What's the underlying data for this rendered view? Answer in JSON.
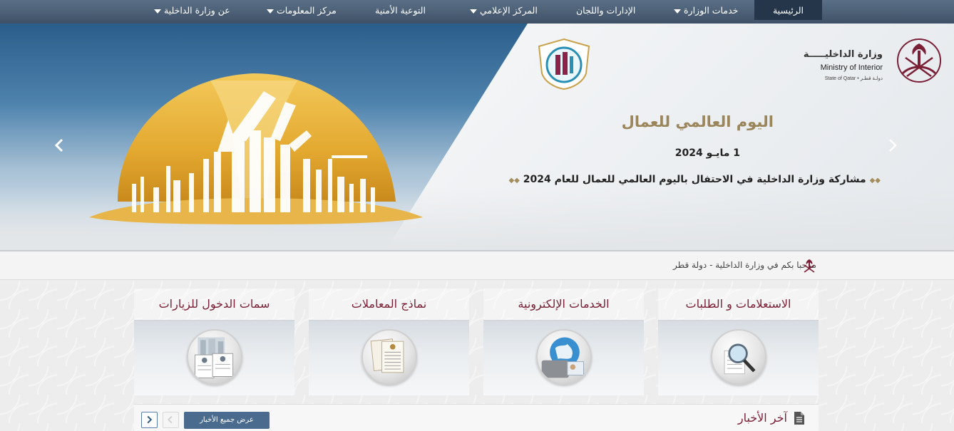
{
  "nav": {
    "items": [
      {
        "label": "الرئيسية",
        "dropdown": false,
        "active": true
      },
      {
        "label": "خدمات الوزارة",
        "dropdown": true,
        "active": false
      },
      {
        "label": "الإدارات واللجان",
        "dropdown": false,
        "active": false
      },
      {
        "label": "المركز الإعلامي",
        "dropdown": true,
        "active": false
      },
      {
        "label": "التوعية الأمنية",
        "dropdown": false,
        "active": false
      },
      {
        "label": "مركز المعلومات",
        "dropdown": true,
        "active": false
      },
      {
        "label": "عن وزارة الداخلية",
        "dropdown": true,
        "active": false
      }
    ]
  },
  "logo": {
    "ar_name": "وزارة الداخليـــــة",
    "en_name": "Ministry of Interior",
    "state": "State of Qatar • دولـة قطـر"
  },
  "slide": {
    "title": "اليوم العالمي للعمال",
    "date": "1 مايـو 2024",
    "caption": "مشاركة وزارة الداخلية في الاحتفال باليوم العالمي للعمال للعام 2024"
  },
  "welcome": {
    "text": "مرحبا بكم في وزارة الداخلية - دولة قطر"
  },
  "cards": [
    {
      "title": "الاستعلامات و الطلبات",
      "icon": "magnifier-document-icon"
    },
    {
      "title": "الخدمات الإلكترونية",
      "icon": "globe-id-card-icon"
    },
    {
      "title": "نماذج المعاملات",
      "icon": "forms-documents-icon"
    },
    {
      "title": "سمات الدخول للزيارات",
      "icon": "visa-documents-icon"
    }
  ],
  "news": {
    "title": "آخر الأخبار",
    "view_all": "عرض جميع الأخبار"
  },
  "colors": {
    "nav_bg": "#4c5f75",
    "nav_active": "#26364a",
    "accent_maroon": "#7a1f35",
    "gold": "#9b855a",
    "button_blue": "#4a6a8e"
  }
}
